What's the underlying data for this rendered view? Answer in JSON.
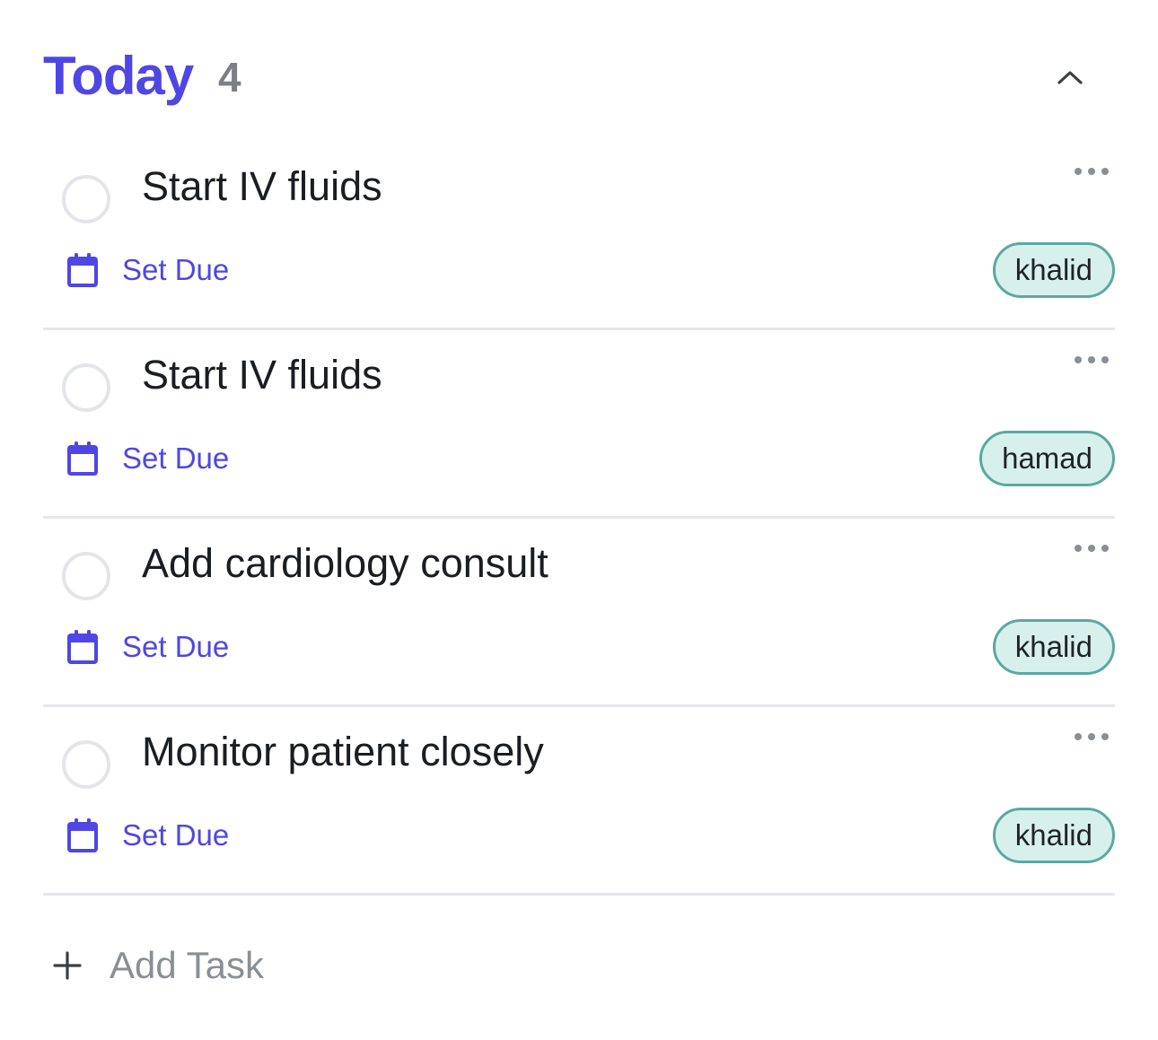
{
  "header": {
    "title": "Today",
    "count": "4",
    "collapse_icon": "chevron-up-icon"
  },
  "tasks": [
    {
      "title": "Start IV fluids",
      "due_label": "Set Due",
      "assignee": "khalid"
    },
    {
      "title": "Start IV fluids",
      "due_label": "Set Due",
      "assignee": "hamad"
    },
    {
      "title": "Add cardiology consult",
      "due_label": "Set Due",
      "assignee": "khalid"
    },
    {
      "title": "Monitor patient closely",
      "due_label": "Set Due",
      "assignee": "khalid"
    }
  ],
  "footer": {
    "add_label": "Add Task",
    "add_icon": "plus-icon"
  },
  "colors": {
    "accent": "#4f46e5",
    "muted": "#8a8f95",
    "tag_bg": "#d8f0ec",
    "tag_border": "#5aa9a3",
    "divider": "#e5e7eb"
  }
}
